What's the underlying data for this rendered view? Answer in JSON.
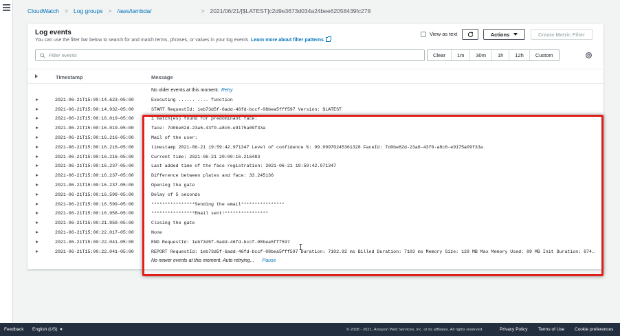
{
  "breadcrumb": {
    "items": [
      "CloudWatch",
      "Log groups",
      "/aws/lambda/"
    ],
    "current": "2021/06/21/[$LATEST]c2d9e3673d034a24bee62058439fc278"
  },
  "panel": {
    "title": "Log events",
    "description": "You can use the filter bar below to search for and match terms, phrases, or values in your log events.",
    "learn_more": "Learn more about filter patterns",
    "view_as_text": "View as text",
    "actions_label": "Actions",
    "create_metric_filter": "Create Metric Filter"
  },
  "filter": {
    "placeholder": "Filter events",
    "time_options": [
      "Clear",
      "1m",
      "30m",
      "1h",
      "12h",
      "Custom"
    ]
  },
  "table": {
    "col_timestamp": "Timestamp",
    "col_message": "Message",
    "top_message": "No older events at this moment.",
    "top_link": "Retry",
    "bottom_message": "No newer events at this moment. Auto retrying...",
    "bottom_link": "Pause",
    "rows": [
      {
        "ts": "2021-06-21T15:00:14.623-05:00",
        "msg": "Executing ...... .... function"
      },
      {
        "ts": "2021-06-21T15:00:14.932-05:00",
        "msg": "START RequestId: 1eb73d5f-6add-46fd-bccf-08bea5fff597 Version: $LATEST"
      },
      {
        "ts": "2021-06-21T15:00:16.019-05:00",
        "msg": "1 match(es) found for predominant face:"
      },
      {
        "ts": "2021-06-21T15:00:16.019-05:00",
        "msg": "face: 7d0be82d-23a6-43f0-a8c6-e9175a09f33a"
      },
      {
        "ts": "2021-06-21T15:00:16.216-05:00",
        "msg": "Mail of the user:"
      },
      {
        "ts": "2021-06-21T15:00:16.216-05:00",
        "msg": "timestamp 2021-06-21 19:59:42.971347 Level of confidence %: 99.99970245361328 FaceId: 7d0be82d-23a6-43f0-a8c6-e9175a09f33a"
      },
      {
        "ts": "2021-06-21T15:00:16.216-05:00",
        "msg": "Current time: 2021-06-21 20:00:16.216483"
      },
      {
        "ts": "2021-06-21T15:00:16.237-05:00",
        "msg": "Last added time of the face registration: 2021-06-21 19:59:42.971347"
      },
      {
        "ts": "2021-06-21T15:00:16.237-05:00",
        "msg": "Difference between plates and face: 33.245136"
      },
      {
        "ts": "2021-06-21T15:00:16.237-05:00",
        "msg": "Opening the gate"
      },
      {
        "ts": "2021-06-21T15:00:16.599-05:00",
        "msg": "Delay of 5 seconds"
      },
      {
        "ts": "2021-06-21T15:00:16.599-05:00",
        "msg": "****************Sending the email****************"
      },
      {
        "ts": "2021-06-21T15:00:16.956-05:00",
        "msg": "****************Email sent!****************"
      },
      {
        "ts": "2021-06-21T15:00:21.959-05:00",
        "msg": "Closing the gate"
      },
      {
        "ts": "2021-06-21T15:00:22.017-05:00",
        "msg": "None"
      },
      {
        "ts": "2021-06-21T15:00:22.041-05:00",
        "msg": "END RequestId: 1eb73d5f-6add-46fd-bccf-08bea5fff597"
      },
      {
        "ts": "2021-06-21T15:00:22.041-05:00",
        "msg": "REPORT RequestId: 1eb73d5f-6add-46fd-bccf-08bea5fff597 Duration: 7102.92 ms Billed Duration: 7103 ms Memory Size: 128 MB Max Memory Used: 89 MB Init Duration: 874.2..."
      }
    ]
  },
  "footer": {
    "feedback": "Feedback",
    "language": "English (US)",
    "copyright": "© 2008 - 2021, Amazon Web Services, Inc. or its affiliates. All rights reserved.",
    "privacy": "Privacy Policy",
    "terms": "Terms of Use",
    "cookies": "Cookie preferences"
  },
  "colors": {
    "link": "#0073bb",
    "highlight_border": "#e0201a",
    "footer_bg": "#232f3e"
  },
  "icons": [
    "menu-icon",
    "search-icon",
    "refresh-icon",
    "external-link-icon",
    "settings-icon",
    "caret-down-icon",
    "expand-row-icon"
  ]
}
